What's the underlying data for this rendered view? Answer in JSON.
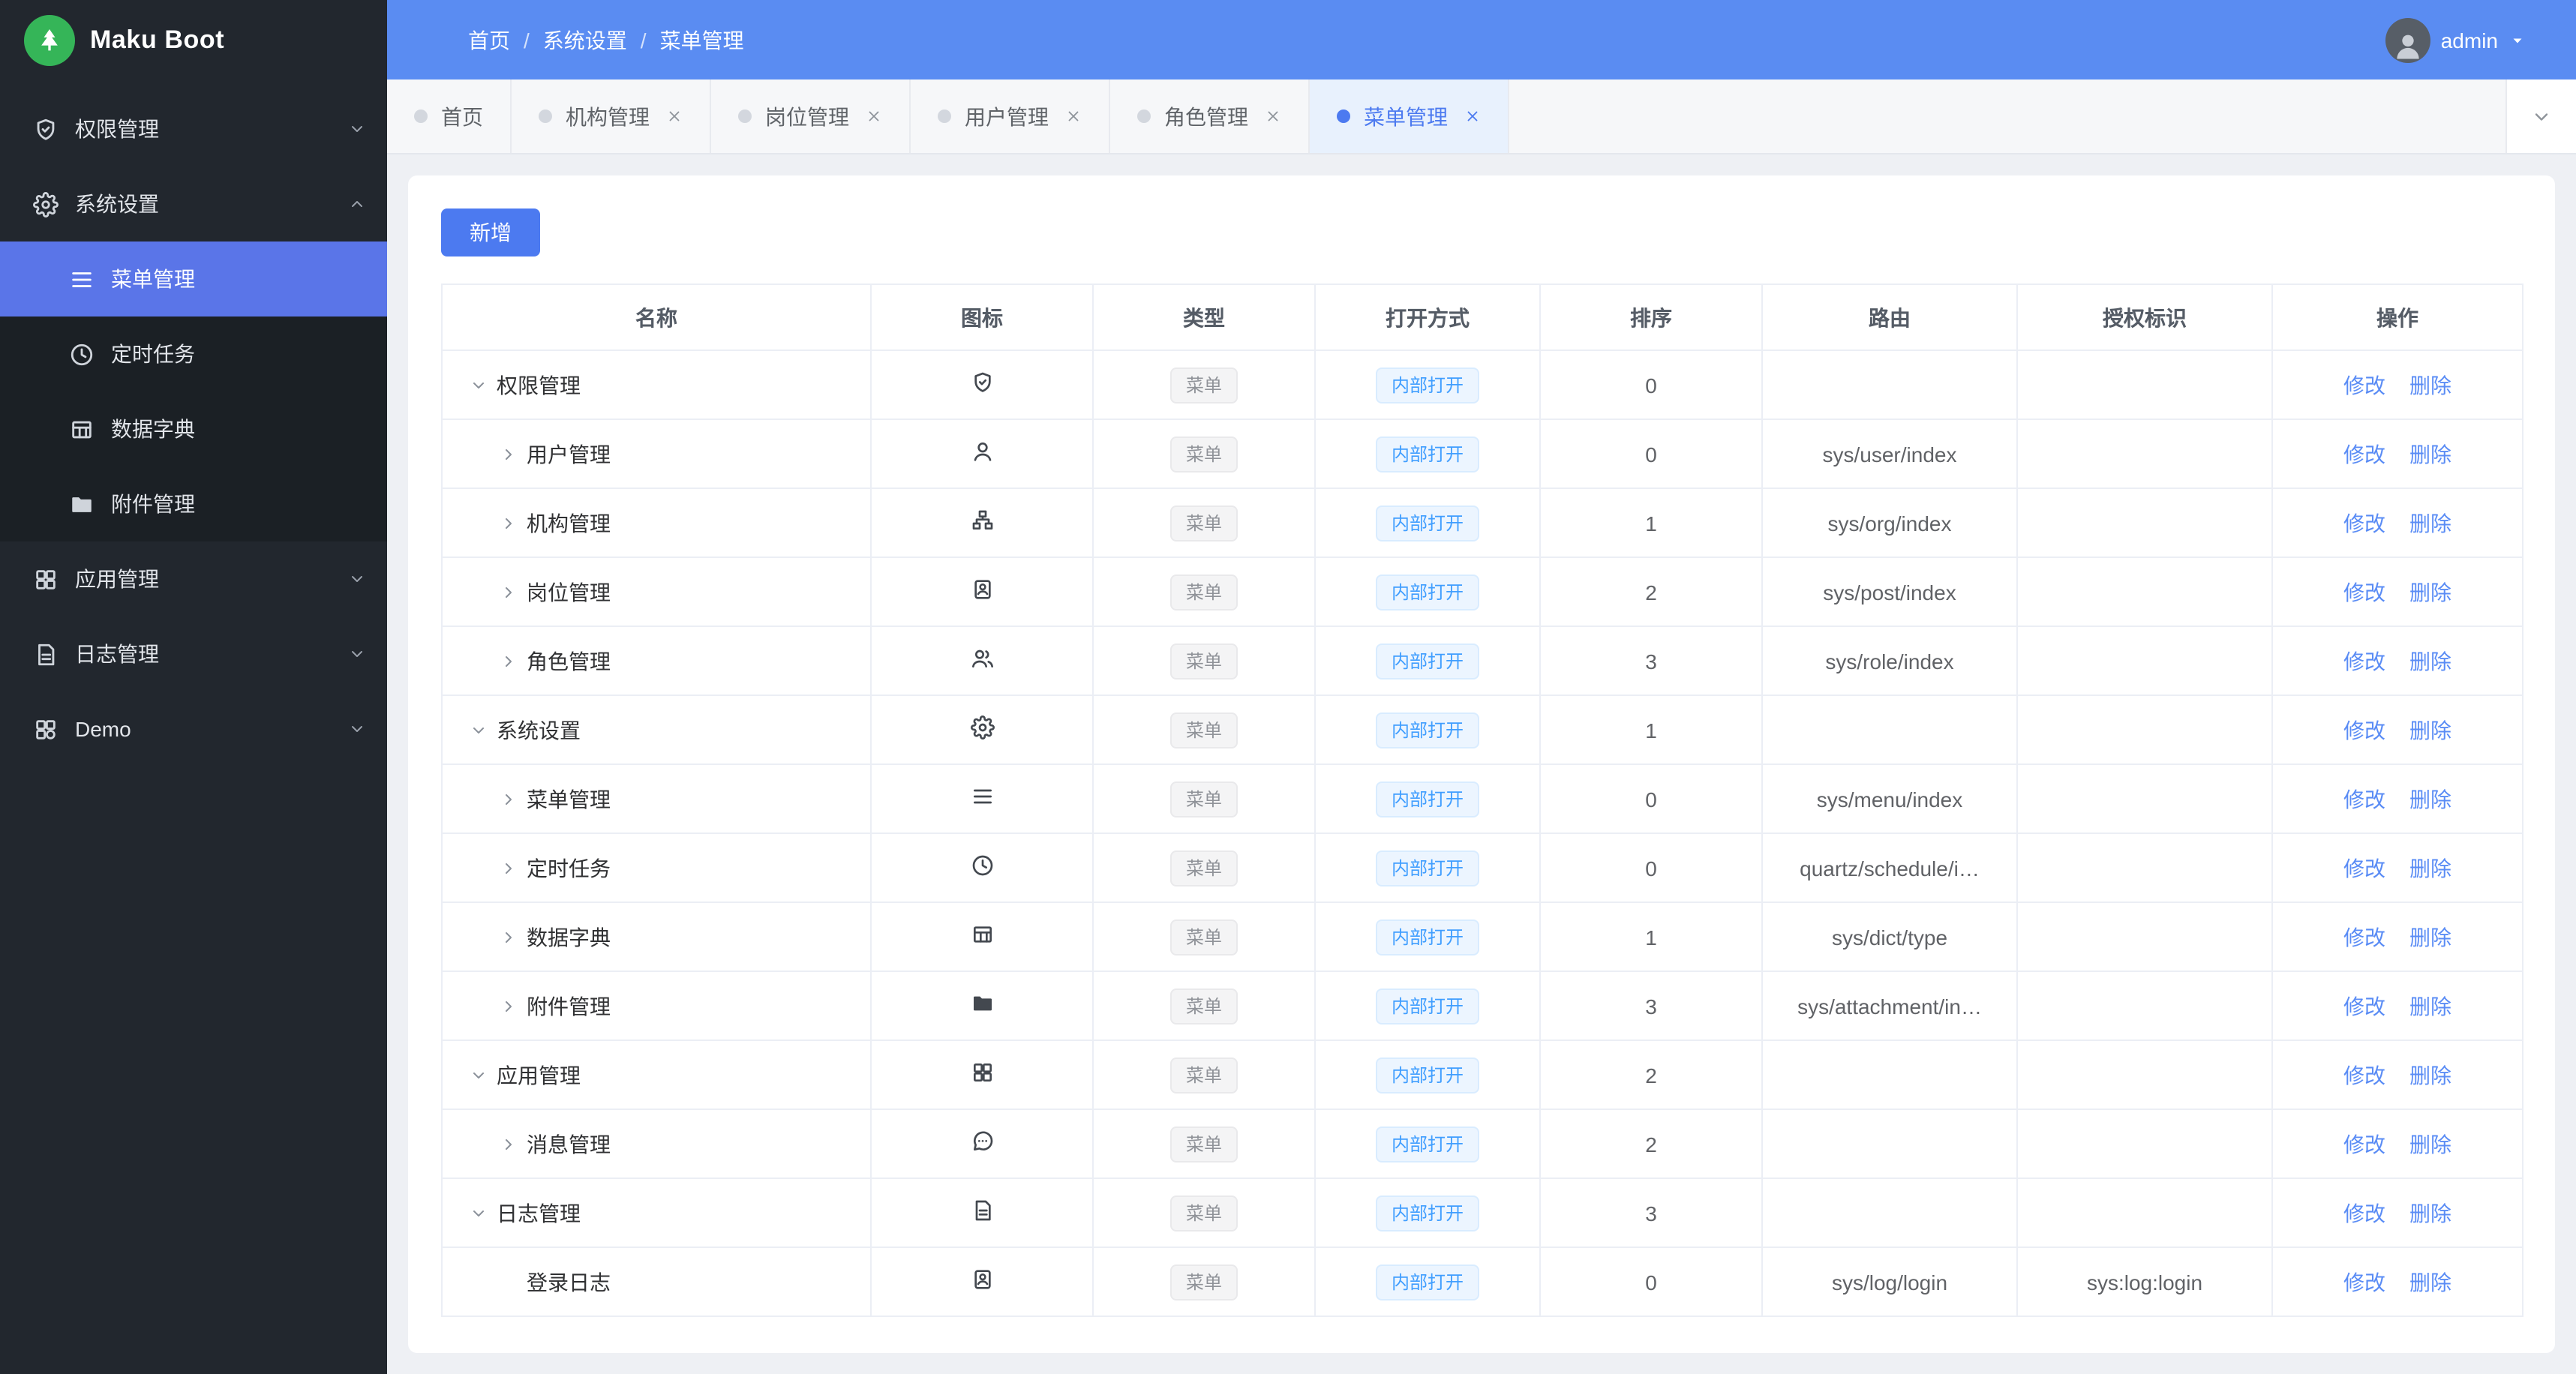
{
  "colors": {
    "primary": "#4c7af0",
    "header": "#5a8cf2",
    "sidebar_active": "#5a75e8",
    "tag_info_text": "#909399",
    "tag_primary_text": "#409eff",
    "logo_green": "#35b558"
  },
  "sidebar": {
    "logo": "Maku Boot",
    "logo_icon": "tree-icon",
    "items": [
      {
        "label": "权限管理",
        "icon": "shield-icon",
        "expanded": false
      },
      {
        "label": "系统设置",
        "icon": "gear-icon",
        "expanded": true,
        "children": [
          {
            "label": "菜单管理",
            "icon": "menu-lines-icon",
            "active": true
          },
          {
            "label": "定时任务",
            "icon": "clock-icon",
            "active": false
          },
          {
            "label": "数据字典",
            "icon": "dict-icon",
            "active": false
          },
          {
            "label": "附件管理",
            "icon": "folder-icon",
            "active": false
          }
        ]
      },
      {
        "label": "应用管理",
        "icon": "apps-icon",
        "expanded": false
      },
      {
        "label": "日志管理",
        "icon": "log-icon",
        "expanded": false
      },
      {
        "label": "Demo",
        "icon": "demo-icon",
        "expanded": false
      }
    ]
  },
  "header": {
    "left_icons": [
      "menu-fold-icon",
      "refresh-icon"
    ],
    "breadcrumb": [
      "首页",
      "系统设置",
      "菜单管理"
    ],
    "breadcrumb_separator": "/",
    "tools": [
      "image-icon",
      "font-size-icon",
      "globe-icon",
      "github-icon",
      "settings-icon",
      "fullscreen-icon"
    ],
    "avatar_icon": "avatar-icon",
    "username": "admin",
    "user_caret": "caret-down-icon",
    "overflow_icon": "kebab-icon"
  },
  "tabbar": {
    "overflow_icon": "chevron-down-icon",
    "tabs": [
      {
        "label": "首页",
        "closable": false,
        "active": false
      },
      {
        "label": "机构管理",
        "closable": true,
        "active": false
      },
      {
        "label": "岗位管理",
        "closable": true,
        "active": false
      },
      {
        "label": "用户管理",
        "closable": true,
        "active": false
      },
      {
        "label": "角色管理",
        "closable": true,
        "active": false
      },
      {
        "label": "菜单管理",
        "closable": true,
        "active": true
      }
    ]
  },
  "toolbar": {
    "add": "新增"
  },
  "table": {
    "columns": [
      "名称",
      "图标",
      "类型",
      "打开方式",
      "排序",
      "路由",
      "授权标识",
      "操作"
    ],
    "tag_type": "菜单",
    "tag_open": "内部打开",
    "action_edit": "修改",
    "action_delete": "删除",
    "rows": [
      {
        "name": "权限管理",
        "icon": "shield-icon",
        "caret": "down",
        "indent": 0,
        "sort": "0",
        "route": "",
        "auth": ""
      },
      {
        "name": "用户管理",
        "icon": "user-icon",
        "caret": "right",
        "indent": 1,
        "sort": "0",
        "route": "sys/user/index",
        "auth": ""
      },
      {
        "name": "机构管理",
        "icon": "org-icon",
        "caret": "right",
        "indent": 1,
        "sort": "1",
        "route": "sys/org/index",
        "auth": ""
      },
      {
        "name": "岗位管理",
        "icon": "post-icon",
        "caret": "right",
        "indent": 1,
        "sort": "2",
        "route": "sys/post/index",
        "auth": ""
      },
      {
        "name": "角色管理",
        "icon": "role-icon",
        "caret": "right",
        "indent": 1,
        "sort": "3",
        "route": "sys/role/index",
        "auth": ""
      },
      {
        "name": "系统设置",
        "icon": "gear-icon",
        "caret": "down",
        "indent": 0,
        "sort": "1",
        "route": "",
        "auth": ""
      },
      {
        "name": "菜单管理",
        "icon": "menu-lines-icon",
        "caret": "right",
        "indent": 1,
        "sort": "0",
        "route": "sys/menu/index",
        "auth": ""
      },
      {
        "name": "定时任务",
        "icon": "clock-icon",
        "caret": "right",
        "indent": 1,
        "sort": "0",
        "route": "quartz/schedule/i…",
        "auth": ""
      },
      {
        "name": "数据字典",
        "icon": "dict-icon",
        "caret": "right",
        "indent": 1,
        "sort": "1",
        "route": "sys/dict/type",
        "auth": ""
      },
      {
        "name": "附件管理",
        "icon": "folder-icon",
        "caret": "right",
        "indent": 1,
        "sort": "3",
        "route": "sys/attachment/in…",
        "auth": ""
      },
      {
        "name": "应用管理",
        "icon": "apps-icon",
        "caret": "down",
        "indent": 0,
        "sort": "2",
        "route": "",
        "auth": ""
      },
      {
        "name": "消息管理",
        "icon": "message-icon",
        "caret": "right",
        "indent": 1,
        "sort": "2",
        "route": "",
        "auth": ""
      },
      {
        "name": "日志管理",
        "icon": "log-icon",
        "caret": "down",
        "indent": 0,
        "sort": "3",
        "route": "",
        "auth": ""
      },
      {
        "name": "登录日志",
        "icon": "login-log-icon",
        "caret": "none",
        "indent": 1,
        "sort": "0",
        "route": "sys/log/login",
        "auth": "sys:log:login"
      }
    ]
  }
}
